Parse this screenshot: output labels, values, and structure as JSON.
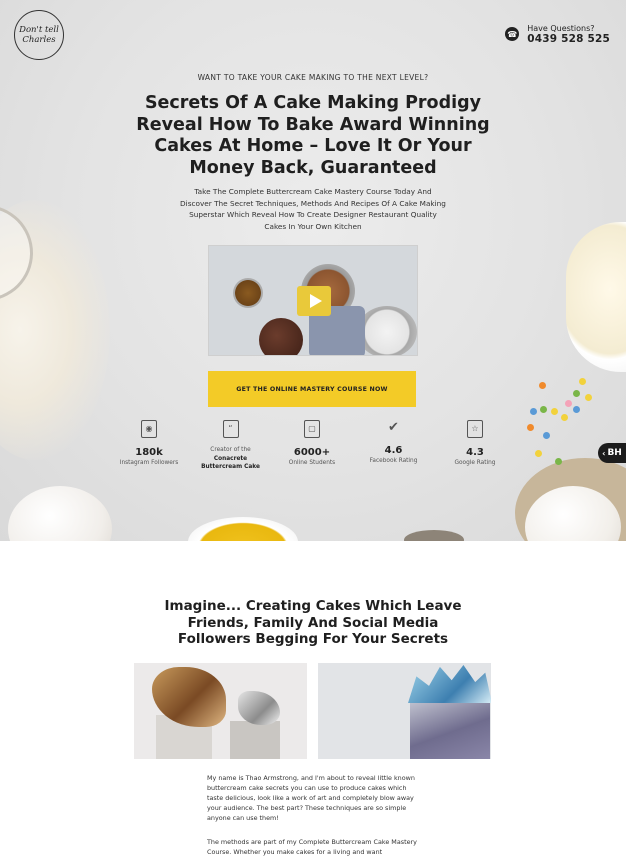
{
  "header": {
    "logo_text": "Don't tell Charles",
    "contact_label": "Have Questions?",
    "phone": "0439 528 525"
  },
  "hero": {
    "kicker": "WANT TO TAKE YOUR CAKE MAKING TO THE NEXT LEVEL?",
    "headline": "Secrets Of A Cake Making Prodigy Reveal How To Bake Award Winning Cakes At Home – Love It Or Your Money Back, Guaranteed",
    "subheadline": "Take The Complete Buttercream Cake Mastery Course Today And Discover The Secret Techniques, Methods And Recipes Of A Cake Making Superstar Which Reveal How To Create Designer Restaurant Quality Cakes In Your Own Kitchen",
    "cta_label": "GET THE ONLINE MASTERY COURSE NOW",
    "badge": "BH",
    "stats": [
      {
        "icon": "instagram-icon",
        "value": "180k",
        "label": "Instagram Followers"
      },
      {
        "icon": "chat-bubble-icon",
        "value": "",
        "label_pre": "Creator of the",
        "label_bold": "Conacrete Buttercream Cake"
      },
      {
        "icon": "laptop-icon",
        "value": "6000+",
        "label": "Online Students"
      },
      {
        "icon": "thumbs-up-icon",
        "value": "4.6",
        "label": "Facebook Rating"
      },
      {
        "icon": "google-icon",
        "value": "4.3",
        "label": "Google Rating"
      }
    ]
  },
  "section2": {
    "title": "Imagine... Creating Cakes Which Leave Friends, Family And Social Media Followers Begging For Your Secrets",
    "paragraph1": "My name is Thao Armstrong, and I'm about to reveal little known buttercream cake secrets you can use to produce cakes which taste delicious, look like a work of art and completely blow away your audience. The best part? These techniques are so simple anyone can use them!",
    "paragraph2": "The methods are part of my Complete Buttercream Cake Mastery Course. Whether you make cakes for a living and want"
  },
  "colors": {
    "accent": "#f3cb27",
    "dark": "#1f1f1f"
  }
}
